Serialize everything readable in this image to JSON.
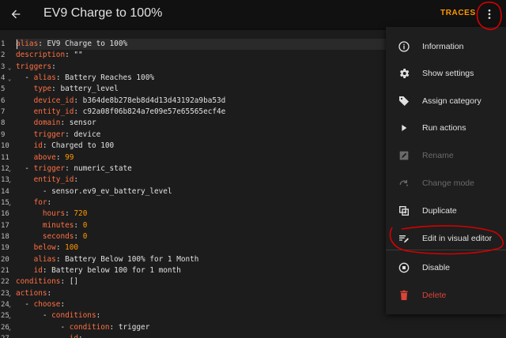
{
  "header": {
    "title": "EV9 Charge to 100%",
    "traces_label": "TRACES"
  },
  "colors": {
    "key": "#ff7043",
    "number": "#ff9800",
    "text": "#e1e1e1",
    "delete": "#db4437",
    "annotation": "#d50000"
  },
  "editor": {
    "lines": [
      {
        "num": "1",
        "fold": false,
        "parts": [
          [
            "k",
            "alias"
          ],
          [
            "v",
            ": EV9 Charge to 100%"
          ]
        ]
      },
      {
        "num": "2",
        "fold": false,
        "parts": [
          [
            "k",
            "description"
          ],
          [
            "v",
            ": \"\""
          ]
        ]
      },
      {
        "num": "3",
        "fold": true,
        "parts": [
          [
            "k",
            "triggers"
          ],
          [
            "v",
            ":"
          ]
        ]
      },
      {
        "num": "4",
        "fold": true,
        "parts": [
          [
            "v",
            "  - "
          ],
          [
            "k",
            "alias"
          ],
          [
            "v",
            ": Battery Reaches 100%"
          ]
        ]
      },
      {
        "num": "5",
        "fold": false,
        "parts": [
          [
            "v",
            "    "
          ],
          [
            "k",
            "type"
          ],
          [
            "v",
            ": battery_level"
          ]
        ]
      },
      {
        "num": "6",
        "fold": false,
        "parts": [
          [
            "v",
            "    "
          ],
          [
            "k",
            "device_id"
          ],
          [
            "v",
            ": b364de8b278eb8d4d13d43192a9ba53d"
          ]
        ]
      },
      {
        "num": "7",
        "fold": false,
        "parts": [
          [
            "v",
            "    "
          ],
          [
            "k",
            "entity_id"
          ],
          [
            "v",
            ": c92a08f06b824a7e09e57e65565ecf4e"
          ]
        ]
      },
      {
        "num": "8",
        "fold": false,
        "parts": [
          [
            "v",
            "    "
          ],
          [
            "k",
            "domain"
          ],
          [
            "v",
            ": sensor"
          ]
        ]
      },
      {
        "num": "9",
        "fold": false,
        "parts": [
          [
            "v",
            "    "
          ],
          [
            "k",
            "trigger"
          ],
          [
            "v",
            ": device"
          ]
        ]
      },
      {
        "num": "10",
        "fold": false,
        "parts": [
          [
            "v",
            "    "
          ],
          [
            "k",
            "id"
          ],
          [
            "v",
            ": Charged to 100"
          ]
        ]
      },
      {
        "num": "11",
        "fold": false,
        "parts": [
          [
            "v",
            "    "
          ],
          [
            "k",
            "above"
          ],
          [
            "v",
            ": "
          ],
          [
            "n",
            "99"
          ]
        ]
      },
      {
        "num": "12",
        "fold": true,
        "parts": [
          [
            "v",
            "  - "
          ],
          [
            "k",
            "trigger"
          ],
          [
            "v",
            ": numeric_state"
          ]
        ]
      },
      {
        "num": "13",
        "fold": true,
        "parts": [
          [
            "v",
            "    "
          ],
          [
            "k",
            "entity_id"
          ],
          [
            "v",
            ":"
          ]
        ]
      },
      {
        "num": "14",
        "fold": false,
        "parts": [
          [
            "v",
            "      - sensor.ev9_ev_battery_level"
          ]
        ]
      },
      {
        "num": "15",
        "fold": true,
        "parts": [
          [
            "v",
            "    "
          ],
          [
            "k",
            "for"
          ],
          [
            "v",
            ":"
          ]
        ]
      },
      {
        "num": "16",
        "fold": false,
        "parts": [
          [
            "v",
            "      "
          ],
          [
            "k",
            "hours"
          ],
          [
            "v",
            ": "
          ],
          [
            "n",
            "720"
          ]
        ]
      },
      {
        "num": "17",
        "fold": false,
        "parts": [
          [
            "v",
            "      "
          ],
          [
            "k",
            "minutes"
          ],
          [
            "v",
            ": "
          ],
          [
            "n",
            "0"
          ]
        ]
      },
      {
        "num": "18",
        "fold": false,
        "parts": [
          [
            "v",
            "      "
          ],
          [
            "k",
            "seconds"
          ],
          [
            "v",
            ": "
          ],
          [
            "n",
            "0"
          ]
        ]
      },
      {
        "num": "19",
        "fold": false,
        "parts": [
          [
            "v",
            "    "
          ],
          [
            "k",
            "below"
          ],
          [
            "v",
            ": "
          ],
          [
            "n",
            "100"
          ]
        ]
      },
      {
        "num": "20",
        "fold": false,
        "parts": [
          [
            "v",
            "    "
          ],
          [
            "k",
            "alias"
          ],
          [
            "v",
            ": Battery Below 100% for 1 Month"
          ]
        ]
      },
      {
        "num": "21",
        "fold": false,
        "parts": [
          [
            "v",
            "    "
          ],
          [
            "k",
            "id"
          ],
          [
            "v",
            ": Battery below 100 for 1 month"
          ]
        ]
      },
      {
        "num": "22",
        "fold": false,
        "parts": [
          [
            "k",
            "conditions"
          ],
          [
            "v",
            ": []"
          ]
        ]
      },
      {
        "num": "23",
        "fold": true,
        "parts": [
          [
            "k",
            "actions"
          ],
          [
            "v",
            ":"
          ]
        ]
      },
      {
        "num": "24",
        "fold": true,
        "parts": [
          [
            "v",
            "  - "
          ],
          [
            "k",
            "choose"
          ],
          [
            "v",
            ":"
          ]
        ]
      },
      {
        "num": "25",
        "fold": true,
        "parts": [
          [
            "v",
            "      - "
          ],
          [
            "k",
            "conditions"
          ],
          [
            "v",
            ":"
          ]
        ]
      },
      {
        "num": "26",
        "fold": true,
        "parts": [
          [
            "v",
            "          - "
          ],
          [
            "k",
            "condition"
          ],
          [
            "v",
            ": trigger"
          ]
        ]
      },
      {
        "num": "27",
        "fold": false,
        "parts": [
          [
            "v",
            "            "
          ],
          [
            "k",
            "id"
          ],
          [
            "v",
            ":"
          ]
        ]
      }
    ]
  },
  "menu": {
    "items": [
      {
        "label": "Information",
        "icon": "info-icon",
        "disabled": false
      },
      {
        "label": "Show settings",
        "icon": "gear-icon",
        "disabled": false
      },
      {
        "label": "Assign category",
        "icon": "tag-icon",
        "disabled": false
      },
      {
        "label": "Run actions",
        "icon": "play-icon",
        "disabled": false
      },
      {
        "label": "Rename",
        "icon": "rename-icon",
        "disabled": true
      },
      {
        "label": "Change mode",
        "icon": "change-mode-icon",
        "disabled": true
      },
      {
        "label": "Duplicate",
        "icon": "duplicate-icon",
        "disabled": false
      },
      {
        "label": "Edit in visual editor",
        "icon": "visual-editor-icon",
        "disabled": false
      },
      {
        "label": "Disable",
        "icon": "disable-icon",
        "disabled": false
      },
      {
        "label": "Delete",
        "icon": "delete-icon",
        "disabled": false
      }
    ]
  }
}
